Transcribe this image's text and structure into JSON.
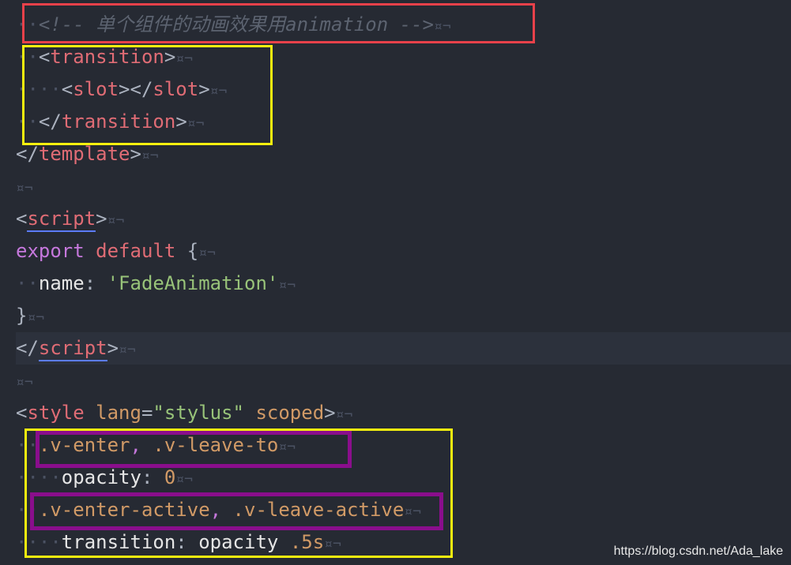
{
  "editor": {
    "comment": {
      "indent": "··",
      "open": "<!--",
      "text": " 单个组件的动画效果用animation ",
      "close": "-->"
    },
    "transition_open": {
      "indent": "··",
      "lt": "<",
      "name": "transition",
      "gt": ">"
    },
    "slot_line": {
      "indent": "····",
      "lt": "<",
      "open_name": "slot",
      "mid": "></",
      "close_name": "slot",
      "gt": ">"
    },
    "transition_close": {
      "indent": "··",
      "lt": "</",
      "name": "transition",
      "gt": ">"
    },
    "template_close": {
      "lt": "</",
      "name": "template",
      "gt": ">"
    },
    "script_open": {
      "lt": "<",
      "name": "script",
      "gt": ">"
    },
    "export_line": {
      "kw1": "export",
      "kw2": "default",
      "brace": "{"
    },
    "name_line": {
      "indent": "··",
      "key": "name",
      "colon": ":",
      "value": "'FadeAnimation'"
    },
    "brace_close": "}",
    "script_close": {
      "lt": "</",
      "name": "script",
      "gt": ">"
    },
    "style_open": {
      "lt": "<",
      "name": "style",
      "attr_name": "lang",
      "eq": "=",
      "attr_value": "\"stylus\"",
      "scoped": "scoped",
      "gt": ">"
    },
    "selector1": {
      "indent": "··",
      "part1": ".v-enter",
      "comma": ",",
      "part2": " .v-leave-to"
    },
    "opacity_line": {
      "indent": "····",
      "prop": "opacity",
      "colon": ":",
      "value": "0"
    },
    "selector2": {
      "indent": "··",
      "part1": ".v-enter-active",
      "comma": ",",
      "part2": " .v-leave-active"
    },
    "transition_line": {
      "indent": "····",
      "prop": "transition",
      "colon": ":",
      "value1": "opacity",
      "value2": ".5s"
    },
    "invisible_marker": "¤¬"
  },
  "annotation_colors": {
    "red": "#e8414a",
    "yellow": "#f5f00f",
    "purple": "#8a0e8c"
  },
  "watermark": "https://blog.csdn.net/Ada_lake"
}
